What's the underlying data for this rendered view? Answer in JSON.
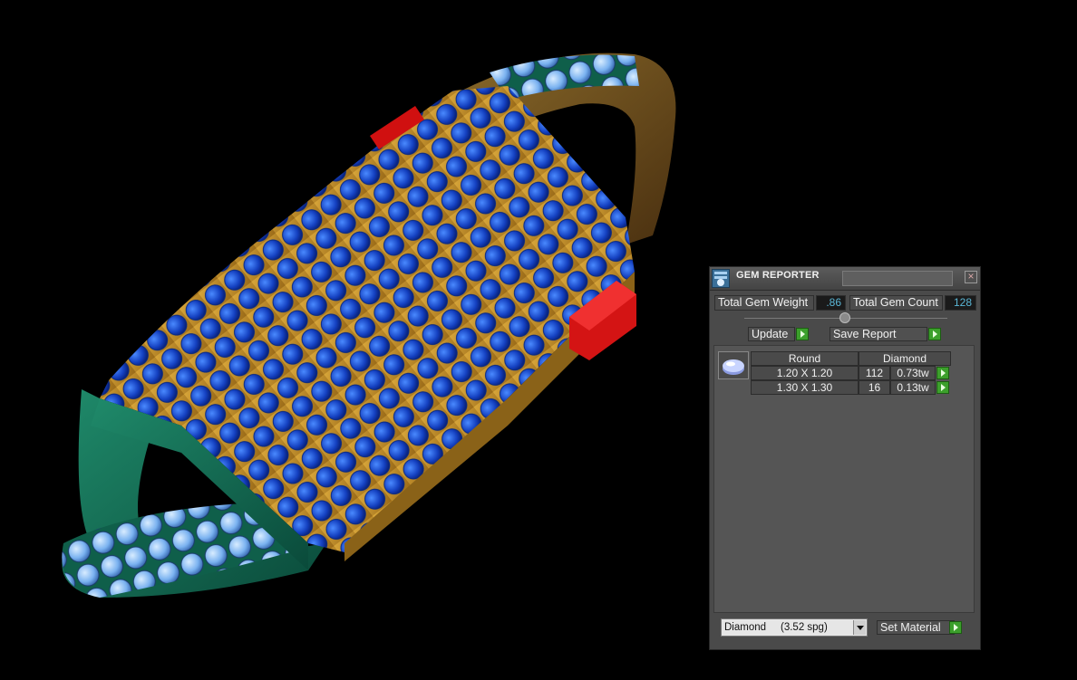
{
  "viewport": {
    "icons": {
      "app": "gem-reporter-app-icon",
      "close": "close-icon",
      "gem_thumbnail": "round-diamond-icon",
      "slider": "slider-knob-icon",
      "dropdown": "chevron-down-icon",
      "go": "green-play-arrow-icon"
    }
  },
  "panel": {
    "title": "GEM REPORTER",
    "close_label": "×",
    "total_gem_weight_label": "Total Gem Weight",
    "total_gem_weight_value": ".86",
    "total_gem_count_label": "Total Gem Count",
    "total_gem_count_value": "128",
    "update_label": "Update",
    "save_report_label": "Save Report",
    "table": {
      "headers": [
        "Round",
        "Diamond"
      ],
      "rows": [
        {
          "size": "1.20 X 1.20",
          "count": "112",
          "weight": "0.73tw"
        },
        {
          "size": "1.30 X 1.30",
          "count": "16",
          "weight": "0.13tw"
        }
      ]
    },
    "material_value": "Diamond     (3.52 spg)",
    "set_material_label": "Set Material",
    "colors": {
      "value_text": "#5ab6d6",
      "go_button": "#3ca02c",
      "panel_bg": "#4a4a4a"
    }
  }
}
